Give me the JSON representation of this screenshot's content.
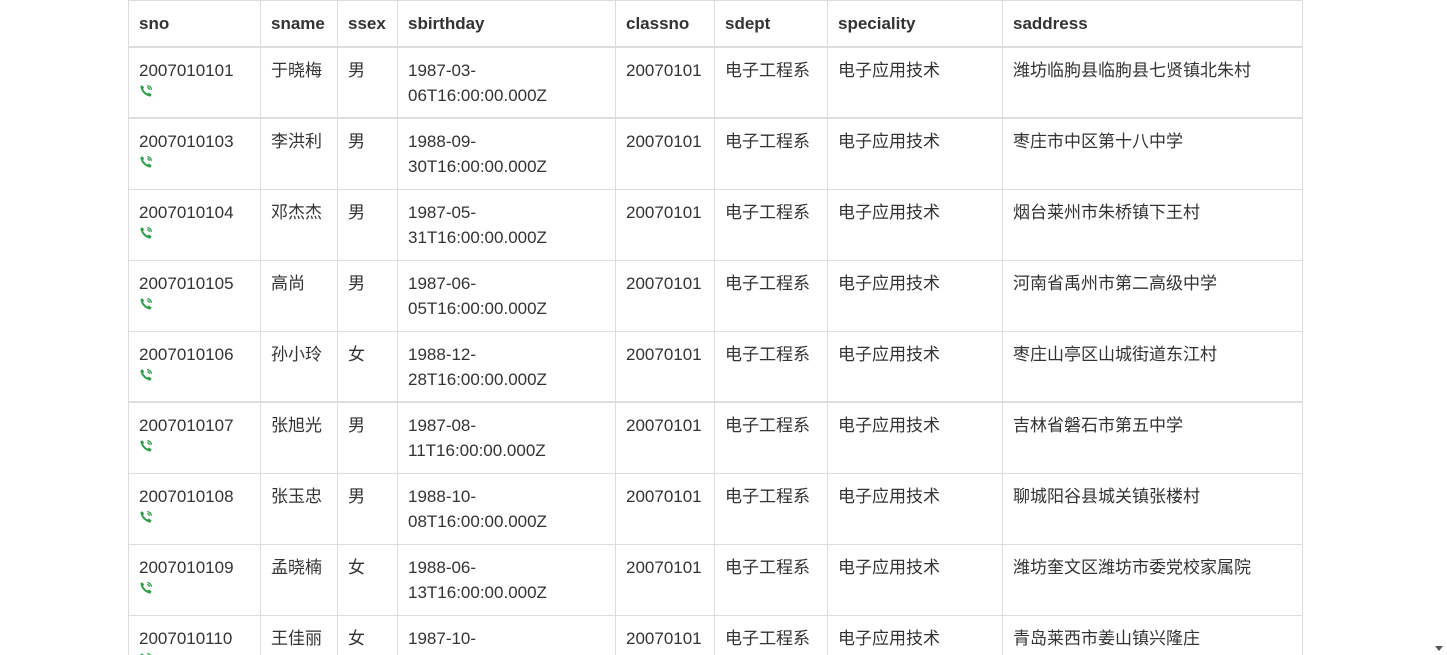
{
  "table": {
    "columns": [
      "sno",
      "sname",
      "ssex",
      "sbirthday",
      "classno",
      "sdept",
      "speciality",
      "saddress"
    ],
    "rows": [
      {
        "sno": "2007010101",
        "sname": "于晓梅",
        "ssex": "男",
        "sbirthday": "1987-03-06T16:00:00.000Z",
        "classno": "20070101",
        "sdept": "电子工程系",
        "speciality": "电子应用技术",
        "saddress": "潍坊临朐县临朐县七贤镇北朱村"
      },
      {
        "sno": "2007010103",
        "sname": "李洪利",
        "ssex": "男",
        "sbirthday": "1988-09-30T16:00:00.000Z",
        "classno": "20070101",
        "sdept": "电子工程系",
        "speciality": "电子应用技术",
        "saddress": "枣庄市中区第十八中学"
      },
      {
        "sno": "2007010104",
        "sname": "邓杰杰",
        "ssex": "男",
        "sbirthday": "1987-05-31T16:00:00.000Z",
        "classno": "20070101",
        "sdept": "电子工程系",
        "speciality": "电子应用技术",
        "saddress": "烟台莱州市朱桥镇下王村"
      },
      {
        "sno": "2007010105",
        "sname": "高尚",
        "ssex": "男",
        "sbirthday": "1987-06-05T16:00:00.000Z",
        "classno": "20070101",
        "sdept": "电子工程系",
        "speciality": "电子应用技术",
        "saddress": "河南省禹州市第二高级中学"
      },
      {
        "sno": "2007010106",
        "sname": "孙小玲",
        "ssex": "女",
        "sbirthday": "1988-12-28T16:00:00.000Z",
        "classno": "20070101",
        "sdept": "电子工程系",
        "speciality": "电子应用技术",
        "saddress": "枣庄山亭区山城街道东江村"
      },
      {
        "sno": "2007010107",
        "sname": "张旭光",
        "ssex": "男",
        "sbirthday": "1987-08-11T16:00:00.000Z",
        "classno": "20070101",
        "sdept": "电子工程系",
        "speciality": "电子应用技术",
        "saddress": "吉林省磐石市第五中学"
      },
      {
        "sno": "2007010108",
        "sname": "张玉忠",
        "ssex": "男",
        "sbirthday": "1988-10-08T16:00:00.000Z",
        "classno": "20070101",
        "sdept": "电子工程系",
        "speciality": "电子应用技术",
        "saddress": "聊城阳谷县城关镇张楼村"
      },
      {
        "sno": "2007010109",
        "sname": "孟晓楠",
        "ssex": "女",
        "sbirthday": "1988-06-13T16:00:00.000Z",
        "classno": "20070101",
        "sdept": "电子工程系",
        "speciality": "电子应用技术",
        "saddress": "潍坊奎文区潍坊市委党校家属院"
      },
      {
        "sno": "2007010110",
        "sname": "王佳丽",
        "ssex": "女",
        "sbirthday": "1987-10-",
        "classno": "20070101",
        "sdept": "电子工程系",
        "speciality": "电子应用技术",
        "saddress": "青岛莱西市姜山镇兴隆庄"
      }
    ],
    "row_icon": "phone-icon",
    "icon_color": "#2e9e4a"
  }
}
